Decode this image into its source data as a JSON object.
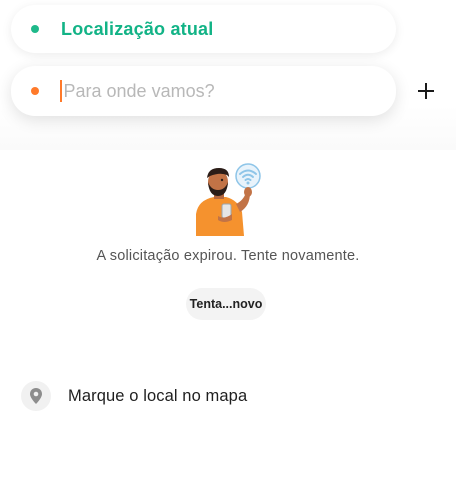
{
  "route": {
    "origin_label": "Localização atual",
    "destination_placeholder": "Para onde vamos?",
    "destination_value": "",
    "add_stop_icon": "plus-icon"
  },
  "error": {
    "illustration": "person-no-signal-illustration",
    "message": "A solicitação expirou. Tente novamente.",
    "retry_label": "Tenta...novo"
  },
  "map_pick": {
    "icon": "map-pin-icon",
    "label": "Marque o local no mapa"
  },
  "colors": {
    "origin_accent": "#12b386",
    "destination_dot": "#ff7a2a",
    "wifi_icon": "#8ec5e8"
  }
}
